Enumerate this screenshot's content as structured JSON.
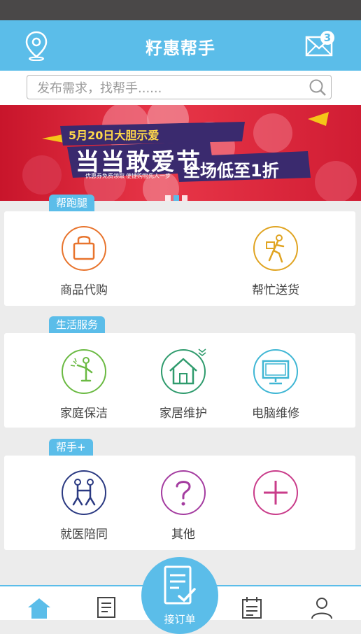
{
  "header": {
    "title": "籽惠帮手",
    "mail_badge": "3"
  },
  "search": {
    "placeholder": "发布需求，找帮手......"
  },
  "banner": {
    "line1": "5月20日大胆示爱",
    "line2": "当当敢爱节",
    "line3": "全场低至1折",
    "small1": "优惠券免费领取",
    "small2": "便捷购物先人一步",
    "slide_count": 3,
    "active_slide": 2
  },
  "sections": [
    {
      "tag": "帮跑腿",
      "items": [
        {
          "label": "商品代购",
          "icon": "shopping-bag-icon"
        },
        {
          "label": "帮忙送货",
          "icon": "delivery-person-icon"
        }
      ]
    },
    {
      "tag": "生活服务",
      "items": [
        {
          "label": "家庭保洁",
          "icon": "cleaner-icon"
        },
        {
          "label": "家居维护",
          "icon": "house-icon"
        },
        {
          "label": "电脑维修",
          "icon": "monitor-icon"
        }
      ]
    },
    {
      "tag": "帮手+",
      "items": [
        {
          "label": "就医陪同",
          "icon": "medical-escort-icon"
        },
        {
          "label": "其他",
          "icon": "question-icon"
        },
        {
          "label": "",
          "icon": "plus-icon"
        }
      ]
    }
  ],
  "tabbar": {
    "fab_label": "接订单",
    "tabs": [
      "home-icon",
      "orders-icon",
      "calendar-icon",
      "profile-icon"
    ]
  },
  "colors": {
    "primary": "#5bbde9",
    "orange": "#e8742d",
    "yellow": "#e0a422",
    "green": "#6bba43",
    "teal": "#2f9b6d",
    "cyan": "#3fb6d4",
    "navy": "#2b3a82",
    "purple": "#a43ca0",
    "magenta": "#c93c8a"
  }
}
